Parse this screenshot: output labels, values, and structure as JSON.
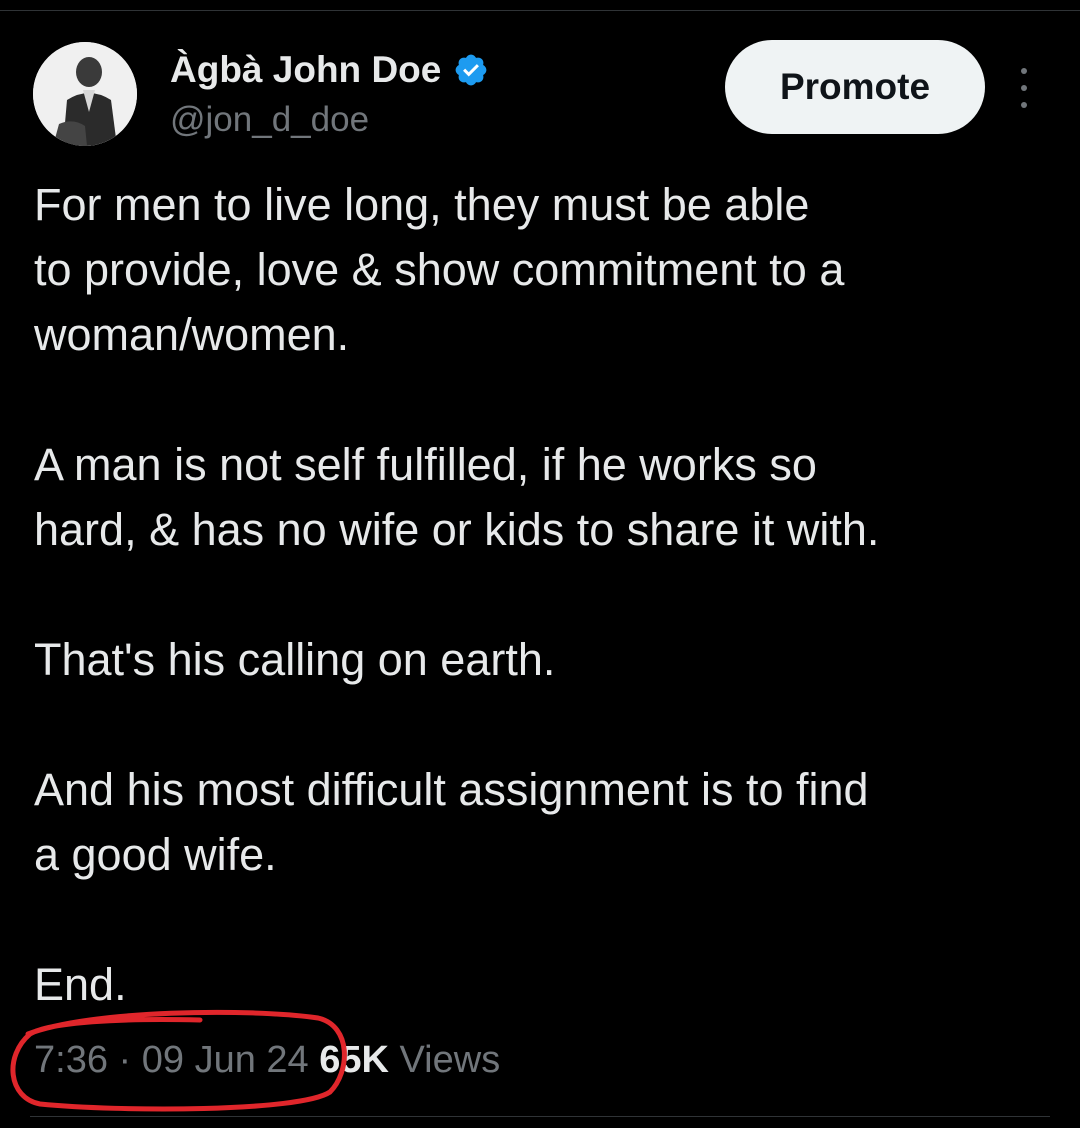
{
  "author": {
    "display_name": "Àgbà John Doe",
    "handle": "@jon_d_doe",
    "verified": true
  },
  "actions": {
    "promote_label": "Promote"
  },
  "tweet": {
    "paragraphs": [
      "For men to live long, they must be able\nto provide, love & show commitment to a\nwoman/women.",
      "A man is not self fulfilled, if he works so\nhard, & has no wife or kids to share it with.",
      "That's his calling on earth.",
      "And his most difficult assignment is to find\na good wife.",
      "End."
    ],
    "time": "7:36",
    "separator": "·",
    "date": "09 Jun 24",
    "views_count": "65K",
    "views_label": "Views"
  },
  "colors": {
    "background": "#000000",
    "text": "#e7e9ea",
    "secondary_text": "#71767b",
    "verified_badge": "#1d9bf0",
    "promote_button": "#eff3f4",
    "annotation": "#e0262b"
  },
  "icons": {
    "verified": "verified-badge-icon",
    "more": "more-vertical-icon"
  }
}
